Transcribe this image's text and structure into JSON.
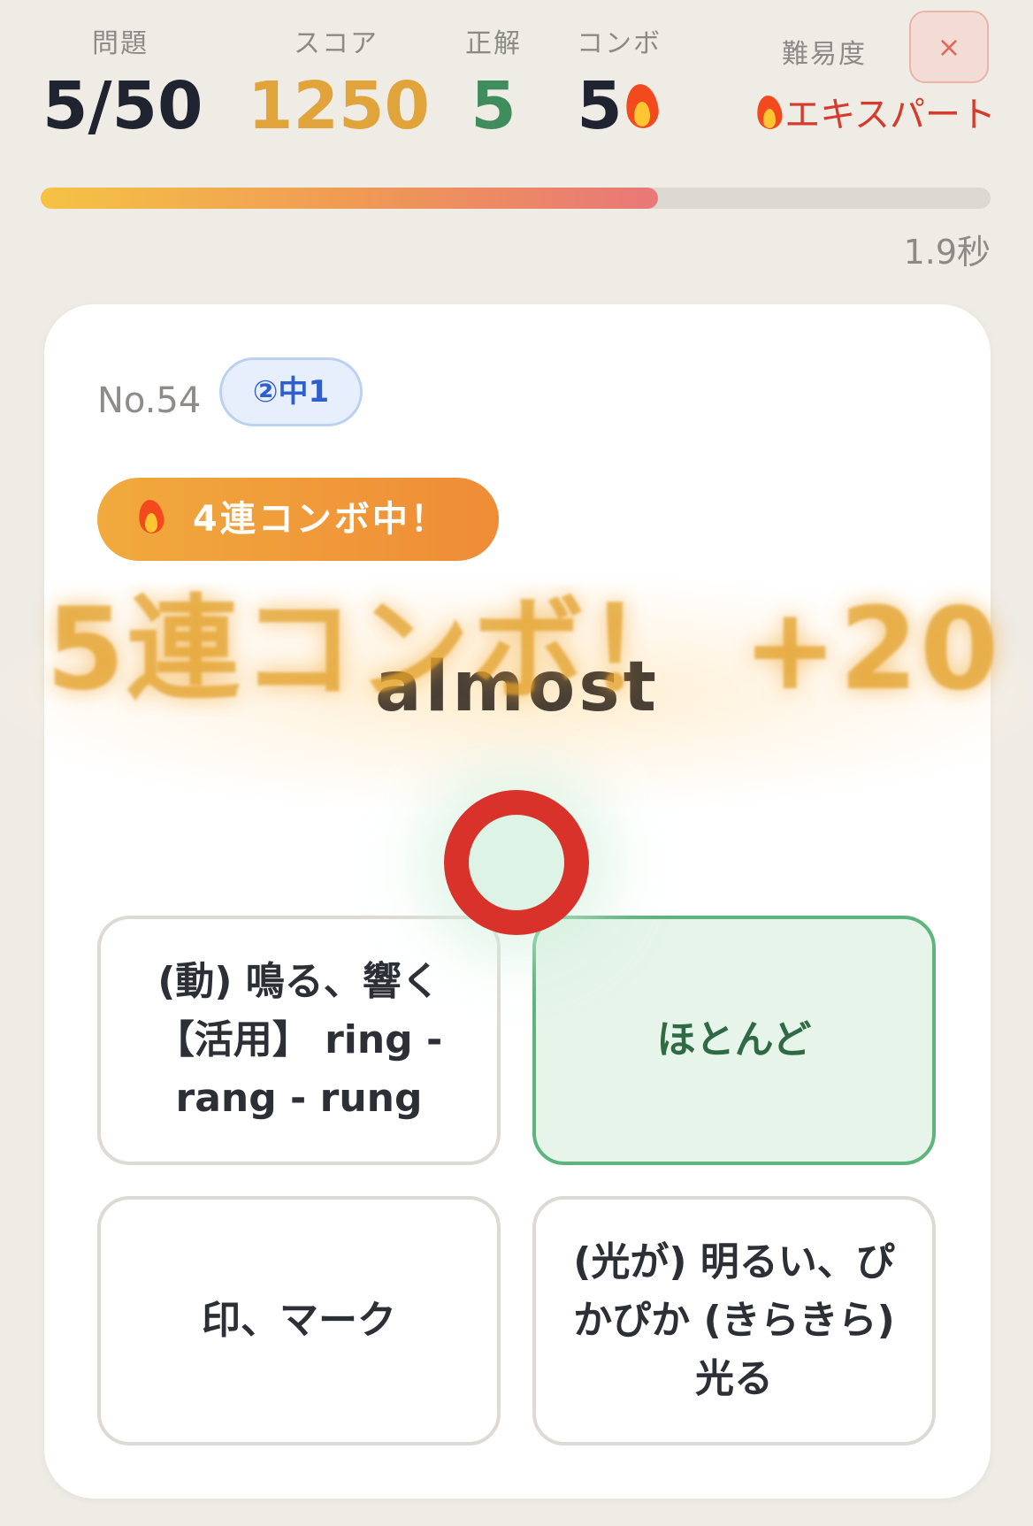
{
  "stats": {
    "question_label": "問題",
    "question_value": "5/50",
    "score_label": "スコア",
    "score_value": "1250",
    "correct_label": "正解",
    "correct_value": "5",
    "combo_label": "コンボ",
    "combo_value": "5",
    "difficulty_label": "難易度",
    "difficulty_value": "エキスパート"
  },
  "close_label": "×",
  "progress": {
    "fraction": 0.65,
    "time": "1.9秒"
  },
  "question": {
    "number": "No.54",
    "grade": "②中1",
    "combo_status": "4連コンボ中！",
    "word": "almost"
  },
  "combo_burst": "5連コンボ！ +20",
  "choices": [
    {
      "text": "(動) 鳴る、響く【活用】 ring - rang - rung",
      "state": "default"
    },
    {
      "text": "ほとんど",
      "state": "correct"
    },
    {
      "text": "印、マーク",
      "state": "default"
    },
    {
      "text": "(光が) 明るい、ぴかぴか (きらきら) 光る",
      "state": "default"
    }
  ],
  "icons": {
    "combo": "fire-icon",
    "difficulty": "fire-icon",
    "result": "correct-circle-icon",
    "close": "close-icon"
  },
  "colors": {
    "accent_orange": "#ef8c37",
    "score_gold": "#e0a43a",
    "correct_green": "#3f8c5c",
    "difficulty_red": "#d43b2c"
  }
}
